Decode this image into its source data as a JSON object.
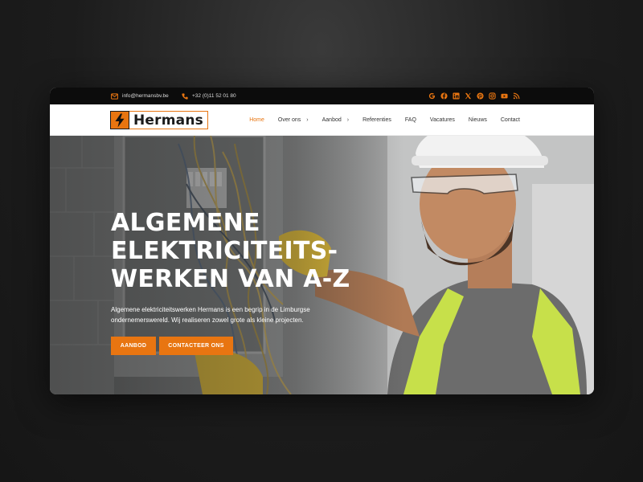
{
  "topbar": {
    "email": "info@hermansbv.be",
    "phone": "+32 (0)11 52 01 80",
    "social_icons": [
      "google-icon",
      "facebook-icon",
      "linkedin-icon",
      "x-icon",
      "pinterest-icon",
      "instagram-icon",
      "youtube-icon",
      "rss-icon"
    ]
  },
  "header": {
    "logo_text": "Hermans",
    "nav": [
      {
        "label": "Home",
        "active": true,
        "has_dropdown": false
      },
      {
        "label": "Over ons",
        "active": false,
        "has_dropdown": true
      },
      {
        "label": "Aanbod",
        "active": false,
        "has_dropdown": true
      },
      {
        "label": "Referenties",
        "active": false,
        "has_dropdown": false
      },
      {
        "label": "FAQ",
        "active": false,
        "has_dropdown": false
      },
      {
        "label": "Vacatures",
        "active": false,
        "has_dropdown": false
      },
      {
        "label": "Nieuws",
        "active": false,
        "has_dropdown": false
      },
      {
        "label": "Contact",
        "active": false,
        "has_dropdown": false
      }
    ]
  },
  "hero": {
    "title_lines": [
      "ALGEMENE",
      "ELEKTRICITEITS-",
      "WERKEN VAN A-Z"
    ],
    "subtitle": "Algemene elektriciteitswerken Hermans is een begrip in de Limburgse ondernemerswereld. Wij realiseren zowel grote als kleine projecten.",
    "primary_button": "AANBOD",
    "secondary_button": "CONTACTEER ONS"
  },
  "colors": {
    "accent": "#e87511",
    "topbar_bg": "#0c0c0c",
    "page_bg": "#1c1c1c"
  }
}
